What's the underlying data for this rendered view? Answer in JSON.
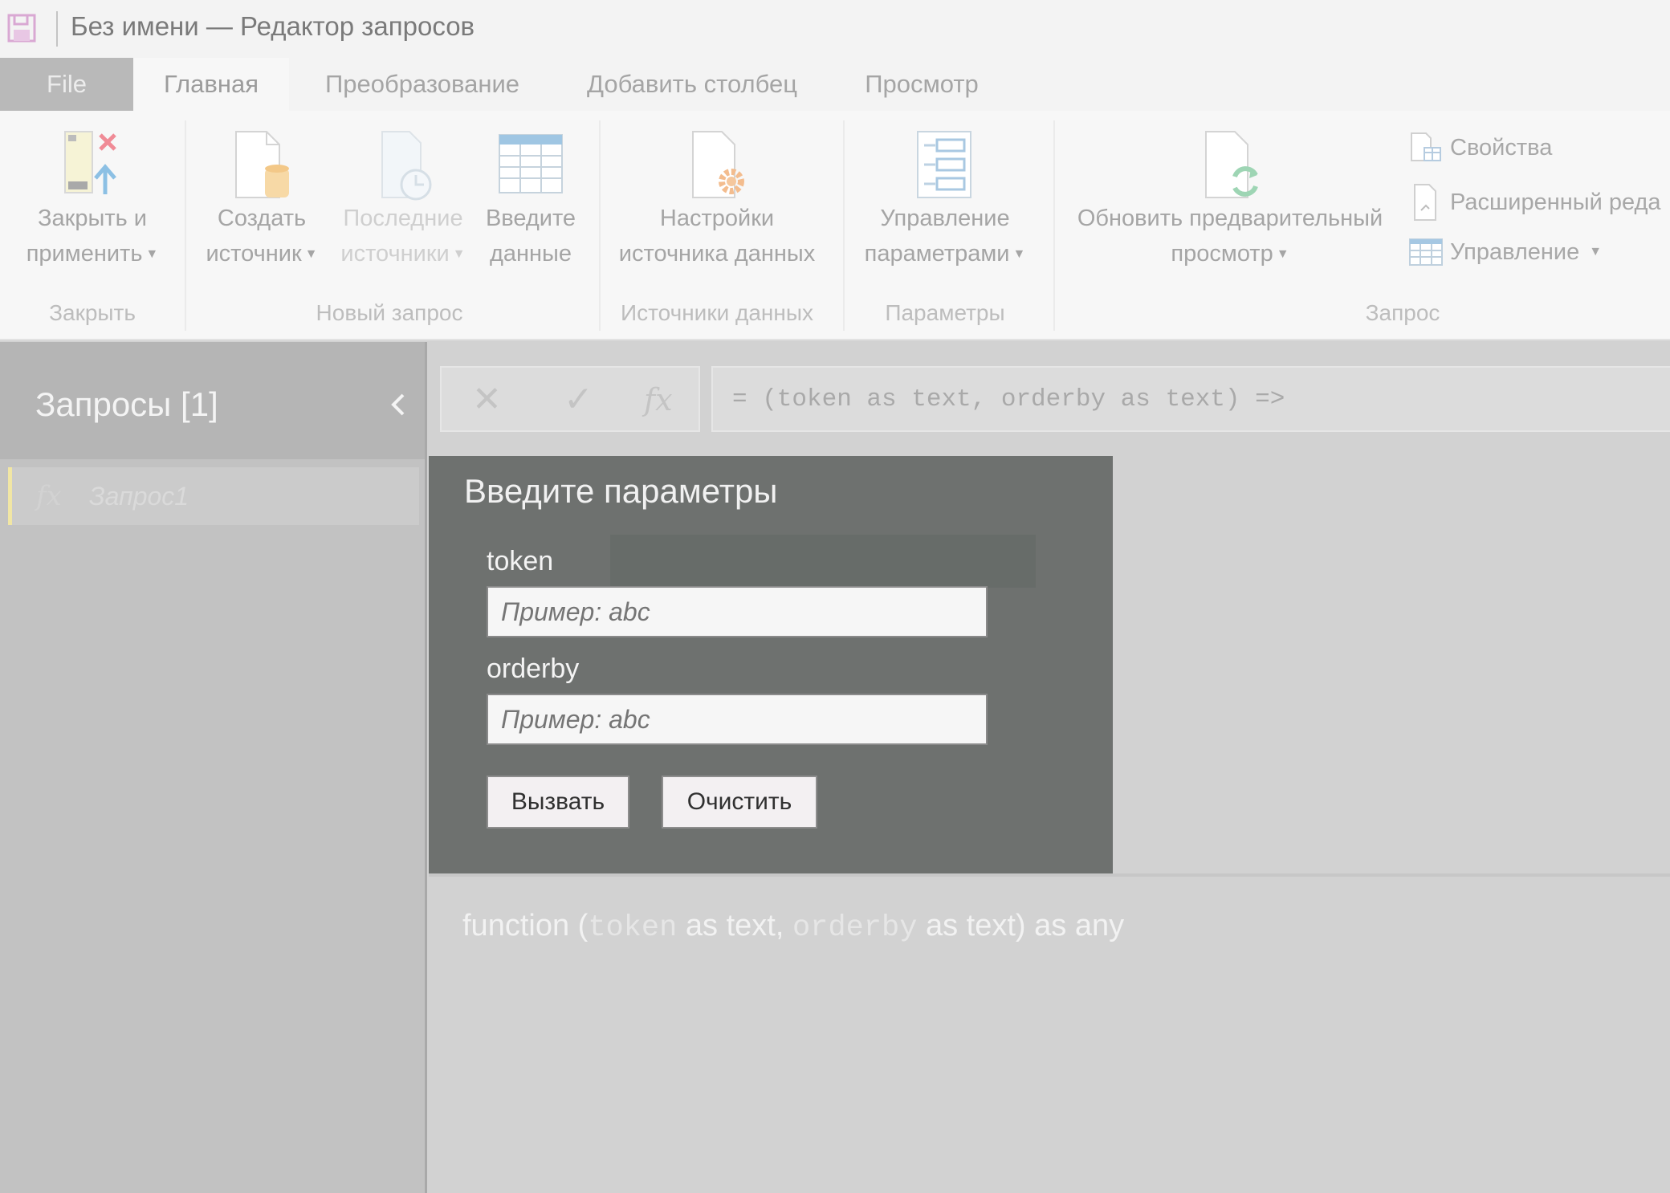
{
  "window": {
    "title": "Без имени — Редактор запросов"
  },
  "tabs": [
    {
      "label": "File"
    },
    {
      "label": "Главная"
    },
    {
      "label": "Преобразование"
    },
    {
      "label": "Добавить столбец"
    },
    {
      "label": "Просмотр"
    }
  ],
  "ribbon": {
    "close_apply": {
      "line1": "Закрыть и",
      "line2": "применить"
    },
    "new_source": {
      "line1": "Создать",
      "line2": "источник"
    },
    "recent_sources": {
      "line1": "Последние",
      "line2": "источники"
    },
    "enter_data": {
      "line1": "Введите",
      "line2": "данные"
    },
    "data_source_settings": {
      "line1": "Настройки",
      "line2": "источника данных"
    },
    "manage_params": {
      "line1": "Управление",
      "line2": "параметрами"
    },
    "refresh_preview": {
      "line1": "Обновить предварительный",
      "line2": "просмотр"
    },
    "properties": "Свойства",
    "advanced_editor": "Расширенный реда",
    "manage": "Управление",
    "groups": {
      "close": "Закрыть",
      "new_query": "Новый запрос",
      "data_sources": "Источники данных",
      "parameters": "Параметры",
      "query": "Запрос"
    }
  },
  "queries_pane": {
    "title": "Запросы [1]",
    "items": [
      {
        "name": "Запрос1"
      }
    ]
  },
  "formula_bar": {
    "fx_label": "fx",
    "formula": "= (token as text, orderby as text) =>"
  },
  "parameter_dialog": {
    "title": "Введите параметры",
    "params": [
      {
        "label": "token",
        "placeholder": "Пример: abc"
      },
      {
        "label": "orderby",
        "placeholder": "Пример: abc"
      }
    ],
    "invoke_label": "Вызвать",
    "clear_label": "Очистить"
  },
  "signature": {
    "keyword": "function",
    "open": "(",
    "p1": "token",
    "t1": "as text,",
    "p2": "orderby",
    "t2": "as text)",
    "ret": "as any"
  },
  "colors": {
    "panel_bg": "#6e716f",
    "pane_bg": "#c2c2c2",
    "selected_marker": "#f1e6a4"
  }
}
